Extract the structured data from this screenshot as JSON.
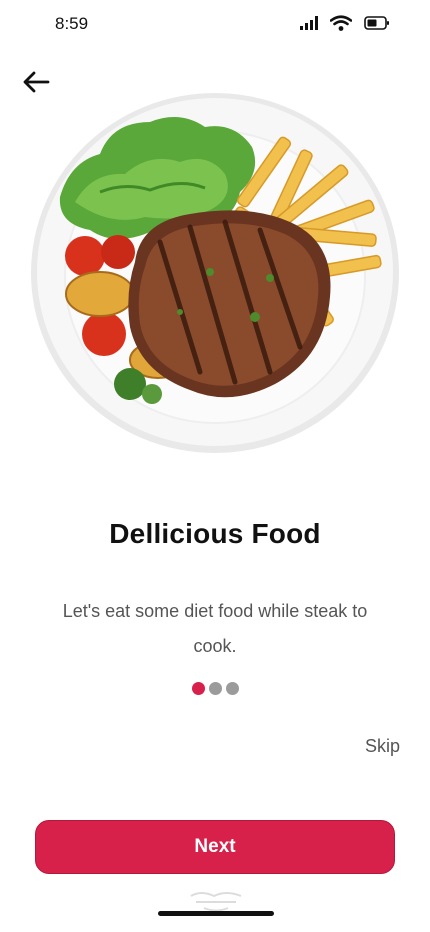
{
  "status_bar": {
    "time": "8:59",
    "icons": [
      "cellular-signal-icon",
      "wifi-icon",
      "battery-icon"
    ]
  },
  "header": {
    "back_icon": "arrow-left-icon"
  },
  "hero": {
    "image": "steak-plate-illustration"
  },
  "onboarding": {
    "title": "Dellicious Food",
    "subtitle": "Let's eat some diet food while steak to cook.",
    "pagination": {
      "total": 3,
      "current": 1
    }
  },
  "actions": {
    "skip_label": "Skip",
    "next_label": "Next"
  },
  "colors": {
    "accent": "#d7204a",
    "dot_inactive": "#9b9b9b",
    "text_muted": "#555555"
  }
}
